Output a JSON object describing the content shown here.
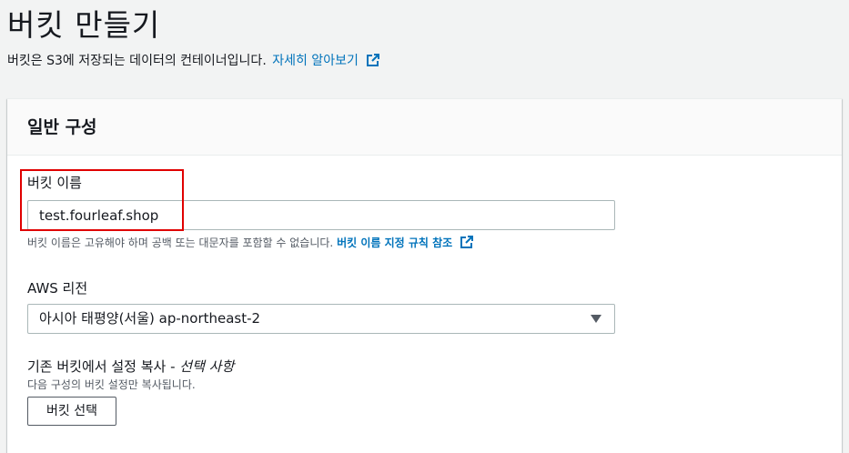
{
  "header": {
    "title": "버킷 만들기",
    "description": "버킷은 S3에 저장되는 데이터의 컨테이너입니다.",
    "learn_more": "자세히 알아보기"
  },
  "panel": {
    "title": "일반 구성",
    "bucket_name": {
      "label": "버킷 이름",
      "value": "test.fourleaf.shop",
      "hint": "버킷 이름은 고유해야 하며 공백 또는 대문자를 포함할 수 없습니다.",
      "hint_link": "버킷 이름 지정 규칙 참조"
    },
    "region": {
      "label": "AWS 리전",
      "selected": "아시아 태평양(서울) ap-northeast-2"
    },
    "copy_settings": {
      "label": "기존 버킷에서 설정 복사 -",
      "optional": "선택 사항",
      "hint": "다음 구성의 버킷 설정만 복사됩니다.",
      "button": "버킷 선택"
    }
  },
  "colors": {
    "link": "#0073bb",
    "highlight": "#e00000",
    "background": "#f2f3f3"
  },
  "icons": {
    "external_link": "external-link-icon",
    "dropdown": "caret-down-icon"
  }
}
